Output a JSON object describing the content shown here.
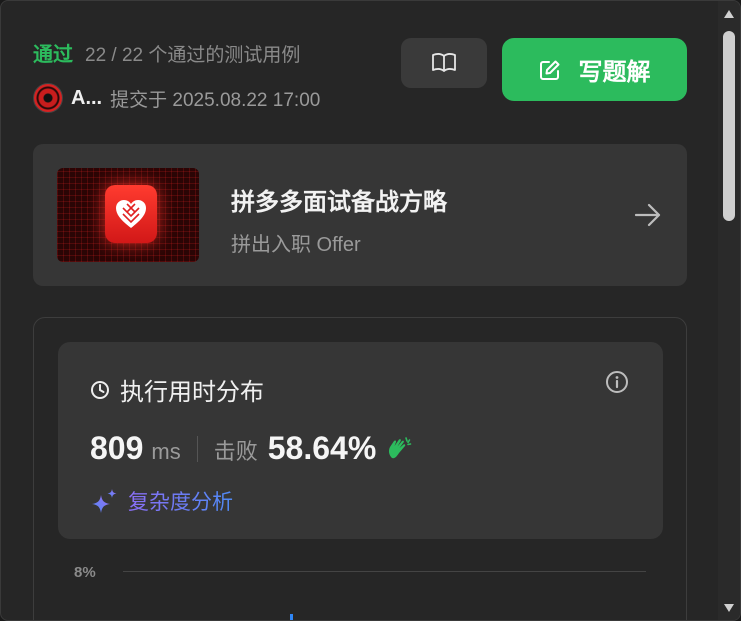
{
  "header": {
    "status": "通过",
    "cases": "22 / 22 个通过的测试用例",
    "author": "A...",
    "submit_info": "提交于 2025.08.22 17:00",
    "write_solution": "写题解"
  },
  "promo": {
    "title": "拼多多面试备战方略",
    "subtitle": "拼出入职 Offer"
  },
  "runtime": {
    "title": "执行用时分布",
    "value": "809",
    "unit": "ms",
    "beat_label": "击败",
    "percent": "58.64%",
    "complexity_label": "复杂度分析"
  },
  "chart_data": {
    "type": "bar",
    "yticks": [
      "8%"
    ]
  },
  "colors": {
    "accent_green": "#2cbb5d",
    "panel_bg": "#262626",
    "card_bg": "#363636",
    "complexity_gradient_start": "#8b6ef5",
    "complexity_gradient_end": "#4f8af5"
  }
}
